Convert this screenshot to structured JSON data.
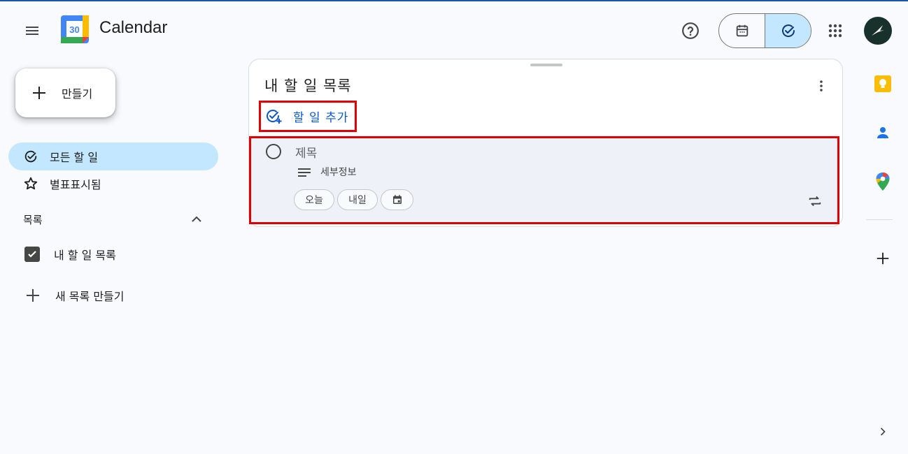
{
  "header": {
    "app_title": "Calendar",
    "logo_number": "30"
  },
  "sidebar": {
    "create_label": "만들기",
    "nav": [
      {
        "label": "모든 할 일",
        "icon": "task-check-icon",
        "active": true
      },
      {
        "label": "별표표시됨",
        "icon": "star-icon",
        "active": false
      }
    ],
    "lists_header": "목록",
    "lists": [
      {
        "label": "내 할 일 목록",
        "checked": true
      }
    ],
    "new_list_label": "새 목록 만들기"
  },
  "panel": {
    "title": "내 할 일 목록",
    "add_task_label": "할 일 추가",
    "task": {
      "title_placeholder": "제목",
      "details_placeholder": "세부정보",
      "chip_today": "오늘",
      "chip_tomorrow": "내일"
    }
  },
  "colors": {
    "accent": "#0b57d0",
    "active_bg": "#c2e7ff",
    "highlight_border": "#e00000"
  }
}
